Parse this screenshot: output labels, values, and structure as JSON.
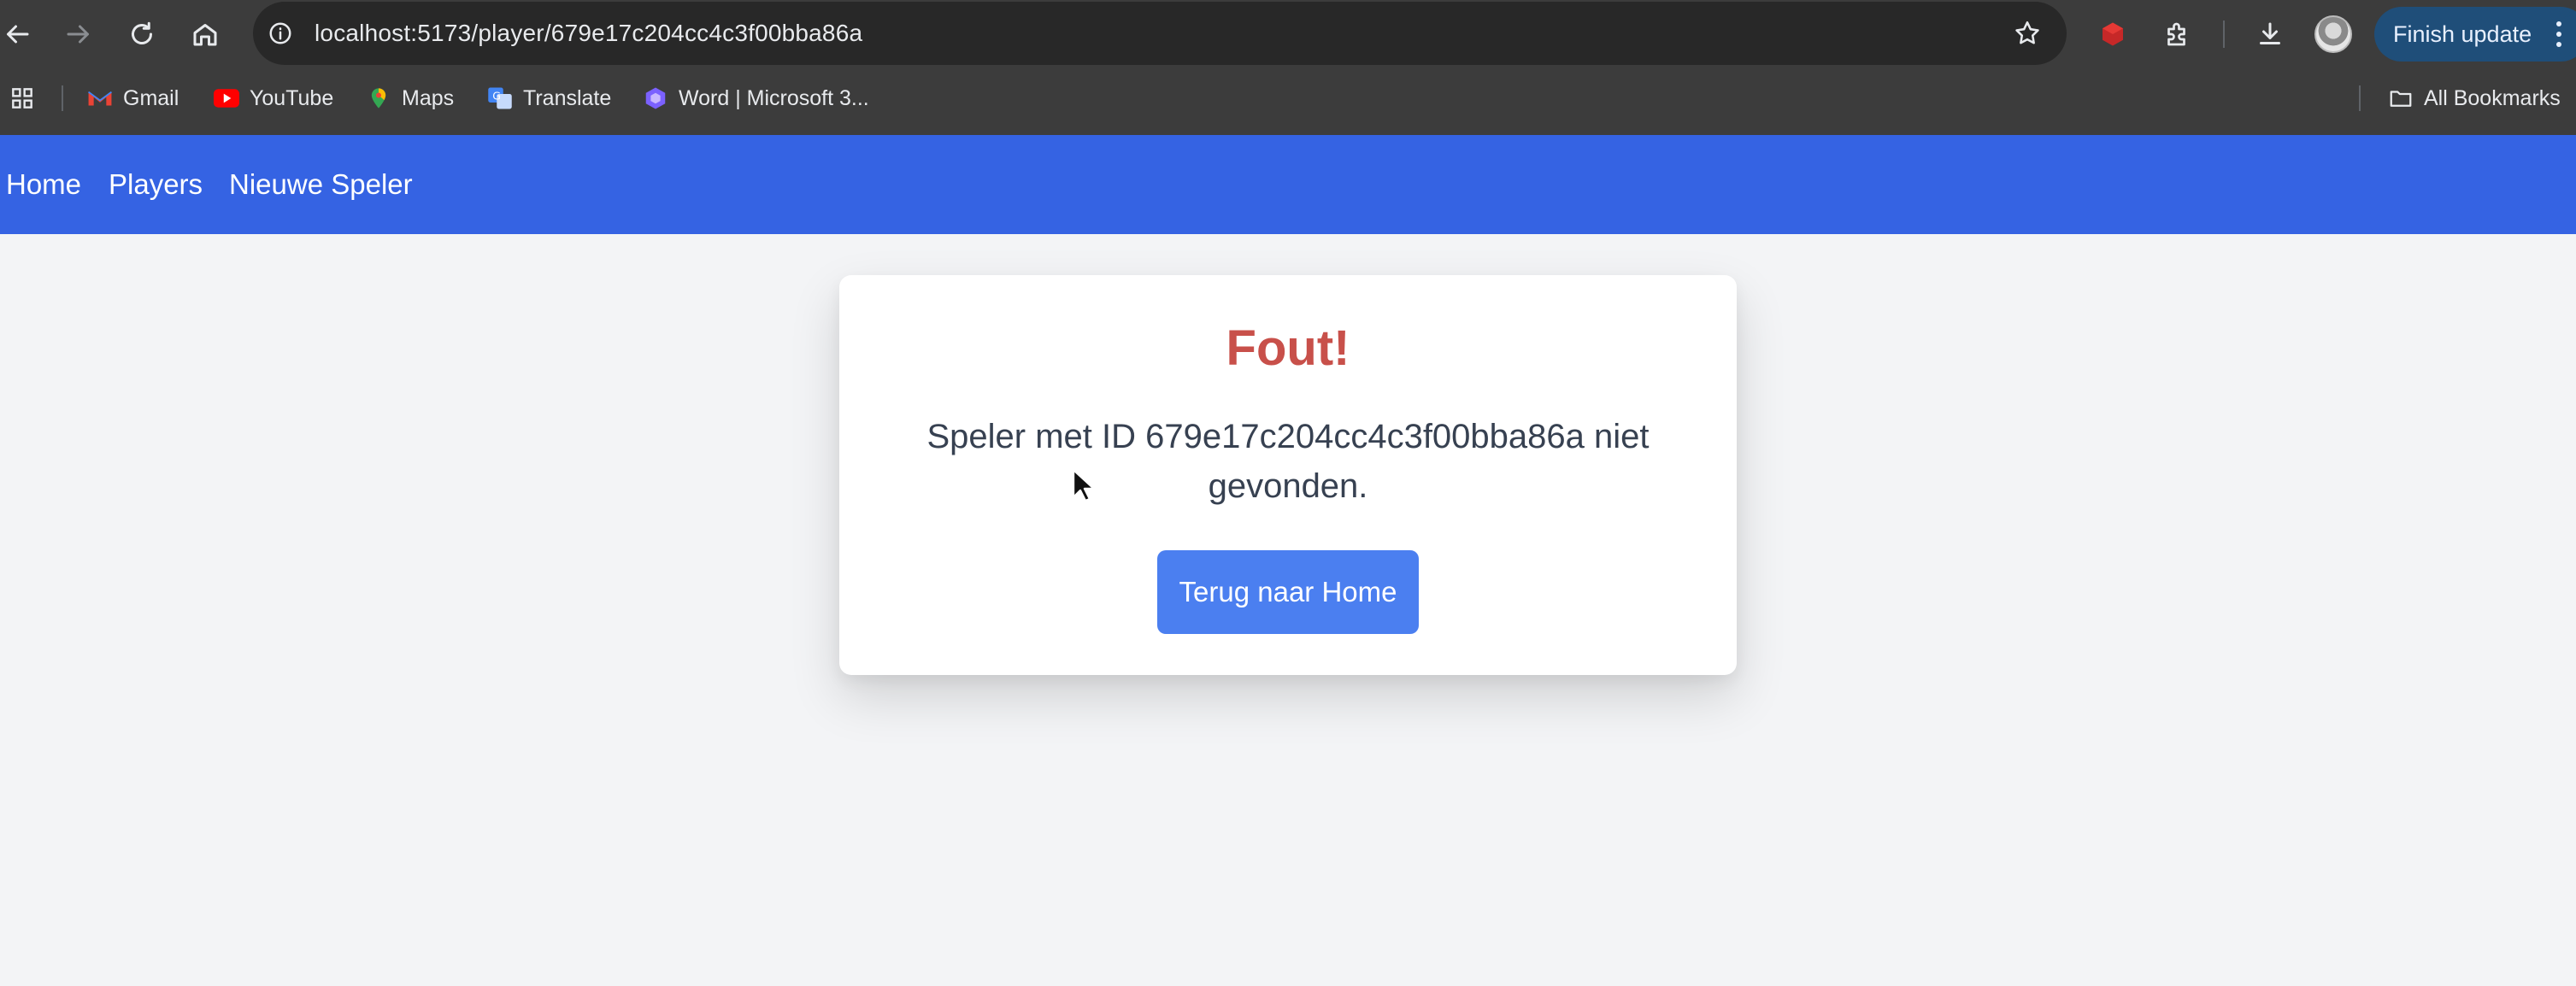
{
  "browser": {
    "url": "localhost:5173/player/679e17c204cc4c3f00bba86a",
    "finish_update_label": "Finish update",
    "bookmarks": [
      {
        "label": "Gmail",
        "icon": "gmail-icon"
      },
      {
        "label": "YouTube",
        "icon": "youtube-icon"
      },
      {
        "label": "Maps",
        "icon": "maps-icon"
      },
      {
        "label": "Translate",
        "icon": "translate-icon"
      },
      {
        "label": "Word | Microsoft 3...",
        "icon": "word-icon"
      }
    ],
    "all_bookmarks_label": "All Bookmarks"
  },
  "nav": {
    "home": "Home",
    "players": "Players",
    "new_player": "Nieuwe Speler"
  },
  "error_card": {
    "title": "Fout!",
    "message": "Speler met ID 679e17c204cc4c3f00bba86a niet gevonden.",
    "button_label": "Terug naar Home"
  },
  "colors": {
    "nav_bg": "#3563e3",
    "error_title": "#c8504a",
    "button_bg": "#4b7ff0",
    "page_bg": "#f3f4f6"
  }
}
